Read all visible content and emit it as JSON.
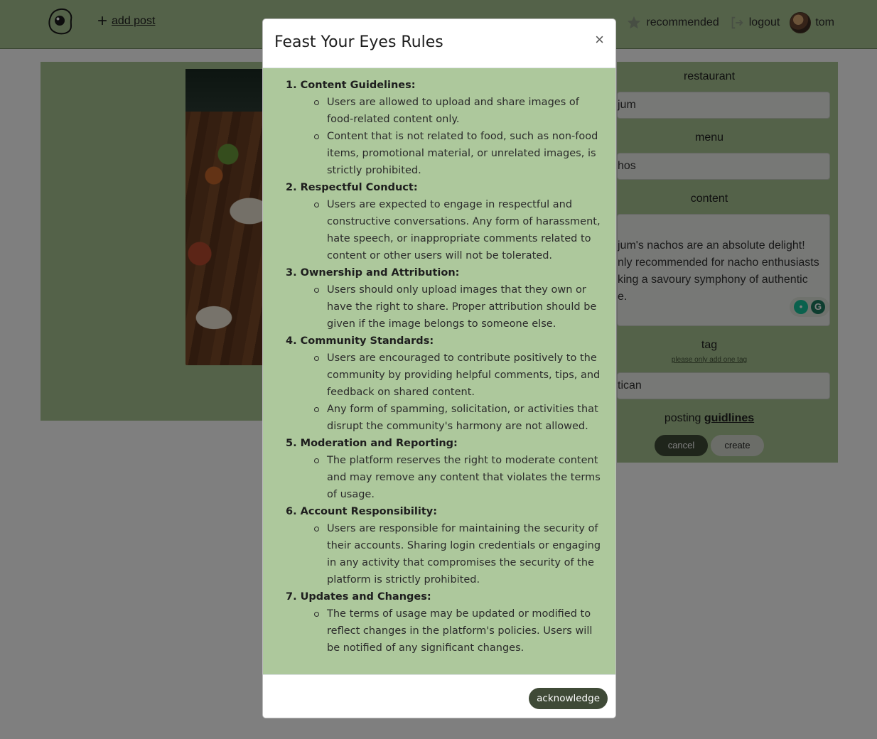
{
  "nav": {
    "add_post_label": "add post",
    "items": [
      {
        "label": "recommended",
        "icon": "star-icon"
      },
      {
        "label": "logout",
        "icon": "logout-icon"
      }
    ],
    "username": "tom"
  },
  "form": {
    "restaurant_label": "restaurant",
    "restaurant_value": "jum",
    "menu_label": "menu",
    "menu_value": "hos",
    "content_label": "content",
    "content_value": "jum's nachos are an absolute delight!\nnly recommended for nacho enthusiasts\nking a savoury symphony of authentic\ne.",
    "tag_label": "tag",
    "tag_hint": "please only add one tag",
    "tag_value": "tican",
    "guidelines_prefix": "posting",
    "guidelines_link": "guidlines",
    "cancel_label": "cancel",
    "create_label": "create"
  },
  "modal": {
    "title": "Feast Your Eyes Rules",
    "close_symbol": "×",
    "rules": [
      {
        "heading": "1. Content Guidelines:",
        "points": [
          "Users are allowed to upload and share images of food-related content only.",
          "Content that is not related to food, such as non-food items, promotional material, or unrelated images, is strictly prohibited."
        ]
      },
      {
        "heading": "2. Respectful Conduct:",
        "points": [
          "Users are expected to engage in respectful and constructive conversations. Any form of harassment, hate speech, or inappropriate comments related to content or other users will not be tolerated."
        ]
      },
      {
        "heading": "3. Ownership and Attribution:",
        "points": [
          "Users should only upload images that they own or have the right to share. Proper attribution should be given if the image belongs to someone else."
        ]
      },
      {
        "heading": "4. Community Standards:",
        "points": [
          "Users are encouraged to contribute positively to the community by providing helpful comments, tips, and feedback on shared content.",
          "Any form of spamming, solicitation, or activities that disrupt the community's harmony are not allowed."
        ]
      },
      {
        "heading": "5. Moderation and Reporting:",
        "points": [
          "The platform reserves the right to moderate content and may remove any content that violates the terms of usage."
        ]
      },
      {
        "heading": "6. Account Responsibility:",
        "points": [
          "Users are responsible for maintaining the security of their accounts. Sharing login credentials or engaging in any activity that compromises the security of the platform is strictly prohibited."
        ]
      },
      {
        "heading": "7. Updates and Changes:",
        "points": [
          "The terms of usage may be updated or modified to reflect changes in the platform's policies. Users will be notified of any significant changes."
        ]
      }
    ],
    "acknowledge_label": "acknowledge"
  }
}
